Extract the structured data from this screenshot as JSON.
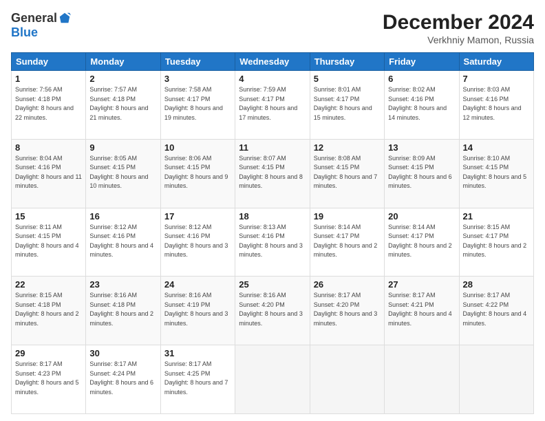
{
  "header": {
    "logo": {
      "general": "General",
      "blue": "Blue"
    },
    "title": "December 2024",
    "subtitle": "Verkhniy Mamon, Russia"
  },
  "calendar": {
    "headers": [
      "Sunday",
      "Monday",
      "Tuesday",
      "Wednesday",
      "Thursday",
      "Friday",
      "Saturday"
    ],
    "rows": [
      [
        {
          "day": "1",
          "sunrise": "7:56 AM",
          "sunset": "4:18 PM",
          "daylight": "8 hours and 22 minutes."
        },
        {
          "day": "2",
          "sunrise": "7:57 AM",
          "sunset": "4:18 PM",
          "daylight": "8 hours and 21 minutes."
        },
        {
          "day": "3",
          "sunrise": "7:58 AM",
          "sunset": "4:17 PM",
          "daylight": "8 hours and 19 minutes."
        },
        {
          "day": "4",
          "sunrise": "7:59 AM",
          "sunset": "4:17 PM",
          "daylight": "8 hours and 17 minutes."
        },
        {
          "day": "5",
          "sunrise": "8:01 AM",
          "sunset": "4:17 PM",
          "daylight": "8 hours and 15 minutes."
        },
        {
          "day": "6",
          "sunrise": "8:02 AM",
          "sunset": "4:16 PM",
          "daylight": "8 hours and 14 minutes."
        },
        {
          "day": "7",
          "sunrise": "8:03 AM",
          "sunset": "4:16 PM",
          "daylight": "8 hours and 12 minutes."
        }
      ],
      [
        {
          "day": "8",
          "sunrise": "8:04 AM",
          "sunset": "4:16 PM",
          "daylight": "8 hours and 11 minutes."
        },
        {
          "day": "9",
          "sunrise": "8:05 AM",
          "sunset": "4:15 PM",
          "daylight": "8 hours and 10 minutes."
        },
        {
          "day": "10",
          "sunrise": "8:06 AM",
          "sunset": "4:15 PM",
          "daylight": "8 hours and 9 minutes."
        },
        {
          "day": "11",
          "sunrise": "8:07 AM",
          "sunset": "4:15 PM",
          "daylight": "8 hours and 8 minutes."
        },
        {
          "day": "12",
          "sunrise": "8:08 AM",
          "sunset": "4:15 PM",
          "daylight": "8 hours and 7 minutes."
        },
        {
          "day": "13",
          "sunrise": "8:09 AM",
          "sunset": "4:15 PM",
          "daylight": "8 hours and 6 minutes."
        },
        {
          "day": "14",
          "sunrise": "8:10 AM",
          "sunset": "4:15 PM",
          "daylight": "8 hours and 5 minutes."
        }
      ],
      [
        {
          "day": "15",
          "sunrise": "8:11 AM",
          "sunset": "4:15 PM",
          "daylight": "8 hours and 4 minutes."
        },
        {
          "day": "16",
          "sunrise": "8:12 AM",
          "sunset": "4:16 PM",
          "daylight": "8 hours and 4 minutes."
        },
        {
          "day": "17",
          "sunrise": "8:12 AM",
          "sunset": "4:16 PM",
          "daylight": "8 hours and 3 minutes."
        },
        {
          "day": "18",
          "sunrise": "8:13 AM",
          "sunset": "4:16 PM",
          "daylight": "8 hours and 3 minutes."
        },
        {
          "day": "19",
          "sunrise": "8:14 AM",
          "sunset": "4:17 PM",
          "daylight": "8 hours and 2 minutes."
        },
        {
          "day": "20",
          "sunrise": "8:14 AM",
          "sunset": "4:17 PM",
          "daylight": "8 hours and 2 minutes."
        },
        {
          "day": "21",
          "sunrise": "8:15 AM",
          "sunset": "4:17 PM",
          "daylight": "8 hours and 2 minutes."
        }
      ],
      [
        {
          "day": "22",
          "sunrise": "8:15 AM",
          "sunset": "4:18 PM",
          "daylight": "8 hours and 2 minutes."
        },
        {
          "day": "23",
          "sunrise": "8:16 AM",
          "sunset": "4:18 PM",
          "daylight": "8 hours and 2 minutes."
        },
        {
          "day": "24",
          "sunrise": "8:16 AM",
          "sunset": "4:19 PM",
          "daylight": "8 hours and 3 minutes."
        },
        {
          "day": "25",
          "sunrise": "8:16 AM",
          "sunset": "4:20 PM",
          "daylight": "8 hours and 3 minutes."
        },
        {
          "day": "26",
          "sunrise": "8:17 AM",
          "sunset": "4:20 PM",
          "daylight": "8 hours and 3 minutes."
        },
        {
          "day": "27",
          "sunrise": "8:17 AM",
          "sunset": "4:21 PM",
          "daylight": "8 hours and 4 minutes."
        },
        {
          "day": "28",
          "sunrise": "8:17 AM",
          "sunset": "4:22 PM",
          "daylight": "8 hours and 4 minutes."
        }
      ],
      [
        {
          "day": "29",
          "sunrise": "8:17 AM",
          "sunset": "4:23 PM",
          "daylight": "8 hours and 5 minutes."
        },
        {
          "day": "30",
          "sunrise": "8:17 AM",
          "sunset": "4:24 PM",
          "daylight": "8 hours and 6 minutes."
        },
        {
          "day": "31",
          "sunrise": "8:17 AM",
          "sunset": "4:25 PM",
          "daylight": "8 hours and 7 minutes."
        },
        null,
        null,
        null,
        null
      ]
    ]
  }
}
